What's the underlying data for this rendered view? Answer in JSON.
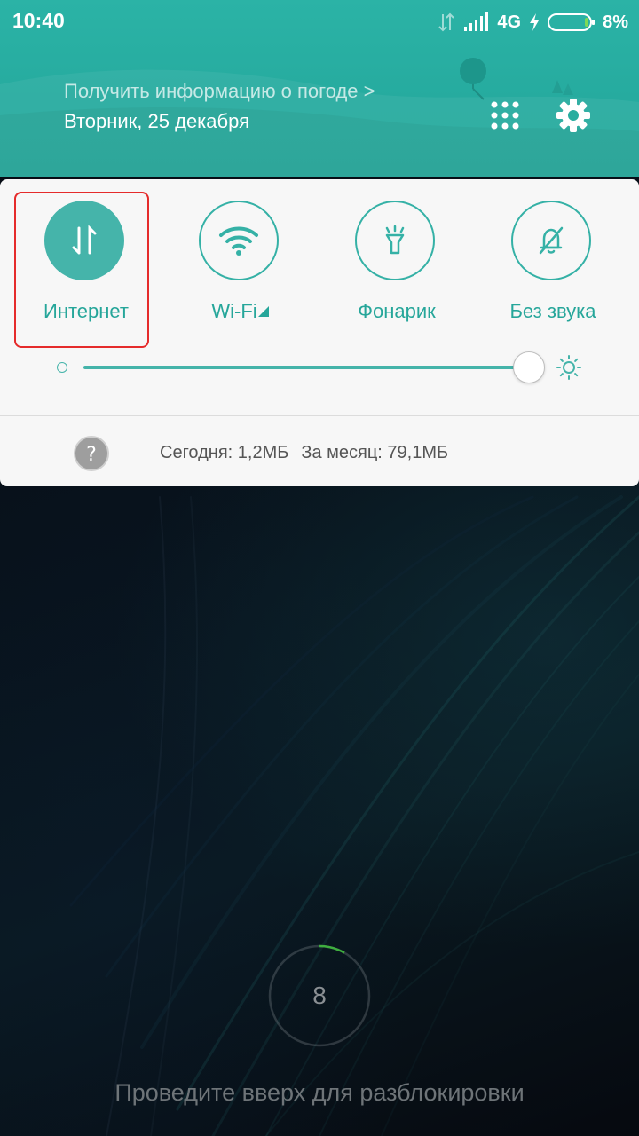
{
  "status_bar": {
    "time": "10:40",
    "network": "4G",
    "battery": "8%"
  },
  "header": {
    "weather_link": "Получить информацию о погоде >",
    "date": "Вторник, 25 декабря"
  },
  "quick_tiles": [
    {
      "label": "Интернет",
      "icon": "data-arrows-icon",
      "active": true
    },
    {
      "label": "Wi-Fi",
      "icon": "wifi-icon",
      "active": false
    },
    {
      "label": "Фонарик",
      "icon": "flashlight-icon",
      "active": false
    },
    {
      "label": "Без звука",
      "icon": "bell-off-icon",
      "active": false
    }
  ],
  "brightness": {
    "level": 1.0
  },
  "data_usage": {
    "today": "Сегодня: 1,2МБ",
    "month": "За месяц: 79,1МБ"
  },
  "lock_screen": {
    "countdown": "8",
    "hint": "Проведите вверх для разблокировки"
  },
  "colors": {
    "accent": "#26a69a",
    "header_bg": "#2bb3a6",
    "highlight": "#e52b2b"
  }
}
